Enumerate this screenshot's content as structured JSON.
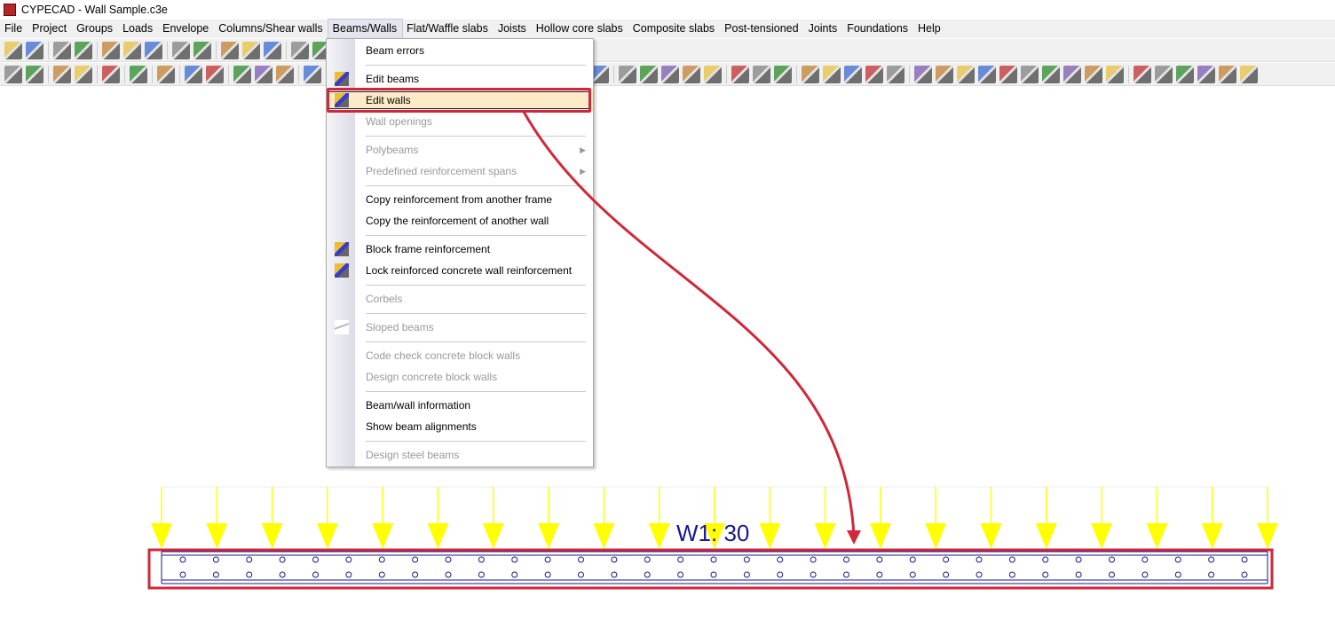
{
  "window": {
    "title": "CYPECAD - Wall Sample.c3e"
  },
  "menubar": [
    "File",
    "Project",
    "Groups",
    "Loads",
    "Envelope",
    "Columns/Shear walls",
    "Beams/Walls",
    "Flat/Waffle slabs",
    "Joists",
    "Hollow core slabs",
    "Composite slabs",
    "Post-tensioned",
    "Joints",
    "Foundations",
    "Help"
  ],
  "active_menu": "Beams/Walls",
  "dropdown": [
    {
      "label": "Beam errors"
    },
    {
      "sep": true
    },
    {
      "label": "Edit beams",
      "icon": "edit-beams-icon"
    },
    {
      "label": "Edit walls",
      "icon": "edit-walls-icon",
      "highlighted": true
    },
    {
      "label": "Wall openings",
      "disabled": true
    },
    {
      "sep": true
    },
    {
      "label": "Polybeams",
      "disabled": true,
      "submenu": true
    },
    {
      "label": "Predefined reinforcement spans",
      "disabled": true,
      "submenu": true
    },
    {
      "sep": true
    },
    {
      "label": "Copy reinforcement from another frame"
    },
    {
      "label": "Copy the reinforcement of another wall"
    },
    {
      "sep": true
    },
    {
      "label": "Block frame reinforcement",
      "icon": "block-frame-icon"
    },
    {
      "label": "Lock reinforced concrete wall reinforcement",
      "icon": "lock-wall-icon"
    },
    {
      "sep": true
    },
    {
      "label": "Corbels",
      "disabled": true
    },
    {
      "sep": true
    },
    {
      "label": "Sloped beams",
      "disabled": true,
      "icon": "sloped-beams-icon"
    },
    {
      "sep": true
    },
    {
      "label": "Code check concrete block walls",
      "disabled": true
    },
    {
      "label": "Design concrete block walls",
      "disabled": true
    },
    {
      "sep": true
    },
    {
      "label": "Beam/wall information"
    },
    {
      "label": "Show beam alignments"
    },
    {
      "sep": true
    },
    {
      "label": "Design steel beams",
      "disabled": true
    }
  ],
  "toolbar1": [
    "open-icon",
    "save-icon",
    "|",
    "colors-icon",
    "tools-icon",
    "|",
    "dxf-icon",
    "dwg-icon",
    "magnet-icon",
    "|",
    "undo-icon",
    "redo-icon",
    "|",
    "up-icon",
    "updown-icon",
    "down-icon",
    "|",
    "zoom-icon",
    "pan-icon"
  ],
  "toolbar2": [
    "view-icon",
    "3d-view-icon",
    "|",
    "stairs-icon",
    "slope-icon",
    "|",
    "eye-ab-icon",
    "|",
    "tag-icon",
    "|",
    "fire-icon",
    "|",
    "box-icon",
    "box-outline-icon",
    "|",
    "edit-icon",
    "eye-icon",
    "gear-icon",
    "|",
    "grid-icon"
  ],
  "toolbar2_right": [
    "grid-icon",
    "|",
    "beam-icon",
    "wall-edit-icon",
    "block-icon",
    "lock-icon",
    "slope-icon",
    "|",
    "grid-a-icon",
    "grid-b-icon",
    "grid-c-icon",
    "|",
    "mesh-a-icon",
    "mesh-b-icon",
    "mesh-c-icon",
    "mesh-d-icon",
    "mesh-e-icon",
    "|",
    "node-icon",
    "dots-icon",
    "t-icon",
    "col-a-icon",
    "col-b-icon",
    "col-c-icon",
    "col-d-icon",
    "col-e-icon",
    "col-f-icon",
    "col-g-icon",
    "|",
    "found-a-icon",
    "found-b-icon",
    "found-c-icon",
    "found-d-icon",
    "found-e-icon",
    "found-f-icon"
  ],
  "wall": {
    "label": "W1: 30",
    "load_arrows": 21,
    "bars_per_row": 33
  },
  "colors": {
    "accent": "#d0283a",
    "load": "#ffff00",
    "wall": "#1a1a8a"
  }
}
